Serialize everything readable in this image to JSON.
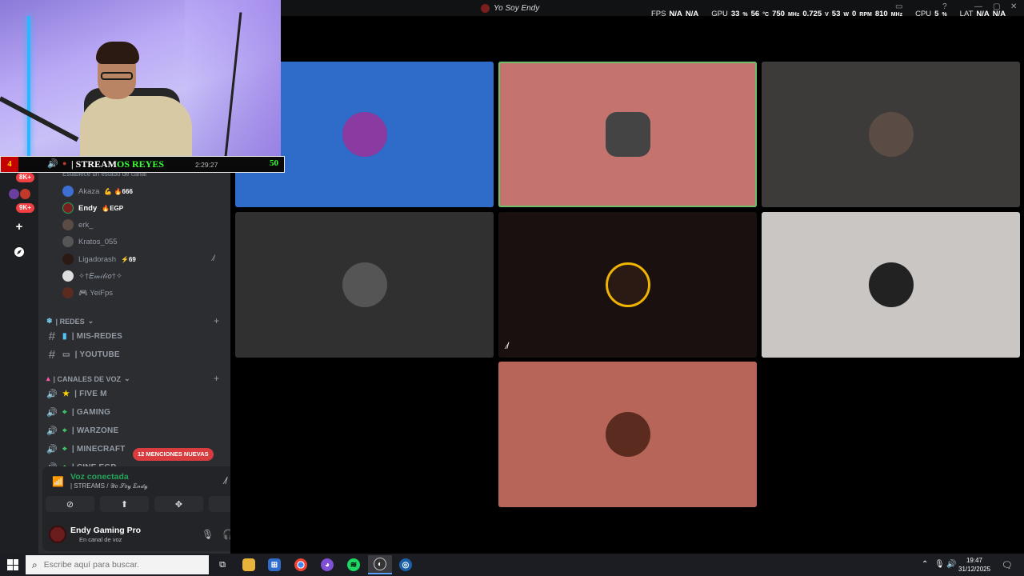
{
  "window": {
    "title": "Yo Soy Endy"
  },
  "osd": {
    "fps_label": "FPS",
    "fps_value_1": "N/A",
    "fps_value_2": "N/A",
    "gpu_label": "GPU",
    "gpu_load": "33",
    "gpu_load_unit": "%",
    "gpu_temp": "56",
    "gpu_temp_unit": "°C",
    "gpu_clock": "750",
    "gpu_clock_unit": "MHz",
    "gpu_volt": "0.725",
    "gpu_volt_unit": "V",
    "gpu_power": "53",
    "gpu_power_unit": "W",
    "gpu_fan": "0",
    "gpu_fan_unit": "RPM",
    "gpu_mem": "810",
    "gpu_mem_unit": "MHz",
    "cpu_label": "CPU",
    "cpu_load": "5",
    "cpu_load_unit": "%",
    "lat_label": "LAT",
    "lat_value_1": "N/A",
    "lat_value_2": "N/A"
  },
  "stream_overlay": {
    "left_number": "4",
    "title_prefix": "| STREAM",
    "title_highlight": "OS REYES",
    "time": "2:29:27",
    "right_number": "50"
  },
  "server_rail": {
    "badge_top": "8K+",
    "badge_bottom": "9K+"
  },
  "channel_panel": {
    "status_hint": "Establece un estado de canal",
    "members": [
      {
        "name": "Akaza",
        "tag": "💪 🔥666"
      },
      {
        "name": "Endy",
        "tag": "🔥EGP"
      },
      {
        "name": "erk_",
        "tag": ""
      },
      {
        "name": "Kratos_055",
        "tag": ""
      },
      {
        "name": "Ligadorash",
        "tag": "⚡69"
      },
      {
        "name": "✧†𝐸𝓂𝒾𝓁𝒾𝑜†✧",
        "tag": ""
      },
      {
        "name": "🎮 YeiFps",
        "tag": ""
      }
    ],
    "category_redes": "| REDES",
    "channels_text": [
      "| MIS-REDES",
      "| YOUTUBE"
    ],
    "category_voz": "| CANALES DE VOZ",
    "channels_voice": [
      "| FIVE M",
      "| GAMING",
      "| WARZONE",
      "| MINECRAFT",
      "| CINE EGP"
    ],
    "mentions_pill": "12 MENCIONES NUEVAS"
  },
  "voice_panel": {
    "title": "Voz conectada",
    "subtitle": "| STREAMS / 𝒴𝑜 𝒮𝑜𝓎 𝐸𝓃𝒹𝓎"
  },
  "user_panel": {
    "name": "Endy Gaming Pro",
    "status": "En canal de voz"
  },
  "video_tiles": [
    {
      "bg": "#2f6bc9",
      "avatar": "#8a3aa0",
      "glyph": "◉"
    },
    {
      "bg": "#c4736f",
      "avatar": "#444",
      "glyph": "☻",
      "speaking": true
    },
    {
      "bg": "#3c3b39",
      "avatar": "#5a4c44",
      "glyph": "☻"
    },
    {
      "bg": "#303030",
      "avatar": "#555",
      "glyph": "☻"
    },
    {
      "bg": "#1a1010",
      "avatar": "#2b1a14",
      "glyph": "◯",
      "muted": true
    },
    {
      "bg": "#c9c6c3",
      "avatar": "#222",
      "glyph": "☗"
    },
    {
      "bg": "#b76558",
      "avatar": "#5a2b1e",
      "glyph": "☻"
    }
  ],
  "taskbar": {
    "search_placeholder": "Escribe aquí para buscar.",
    "time": "19:47",
    "date": "31/12/2025"
  },
  "colors": {
    "discord_green": "#23a55a",
    "discord_red": "#f23f43",
    "accent_blue": "#5aa0ff"
  }
}
